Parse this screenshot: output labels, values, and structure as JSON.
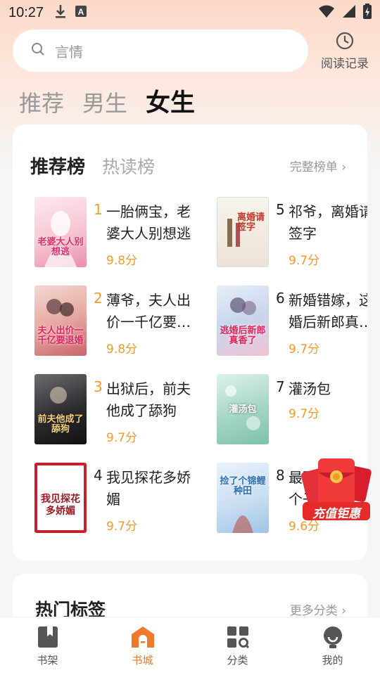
{
  "status_bar": {
    "time": "10:27"
  },
  "search": {
    "placeholder": "言情"
  },
  "history": {
    "label": "阅读记录"
  },
  "category_tabs": [
    {
      "label": "推荐",
      "active": false
    },
    {
      "label": "男生",
      "active": false
    },
    {
      "label": "女生",
      "active": true
    }
  ],
  "ranking": {
    "tabs": [
      {
        "label": "推荐榜",
        "active": true
      },
      {
        "label": "热读榜",
        "active": false
      }
    ],
    "more_label": "完整榜单 ›",
    "books": [
      {
        "rank": "1",
        "title": "一胎俩宝，老\n婆大人别想逃",
        "score": "9.8分",
        "cover_text": "老婆大人别想逃"
      },
      {
        "rank": "2",
        "title": "薄爷，夫人出\n价一千亿要…",
        "score": "9.8分",
        "cover_text": "夫人出价一千亿要退婚"
      },
      {
        "rank": "3",
        "title": "出狱后，前夫\n他成了舔狗",
        "score": "9.7分",
        "cover_text": "前夫他成了舔狗"
      },
      {
        "rank": "4",
        "title": "我见探花多娇\n媚",
        "score": "9.7分",
        "cover_text": "我见探花多娇媚"
      },
      {
        "rank": "5",
        "title": "祁爷，离婚请\n签字",
        "score": "9.7分",
        "cover_text": "离婚请签字"
      },
      {
        "rank": "6",
        "title": "新婚错嫁，这\n婚后新郎真…",
        "score": "9.7分",
        "cover_text": "逃婚后新郎真香了"
      },
      {
        "rank": "7",
        "title": "灌汤包",
        "score": "9.7分",
        "cover_text": "灌汤包"
      },
      {
        "rank": "8",
        "title": "最强\n个子",
        "score": "9.6分",
        "cover_text": "捡了个锦鲤种田"
      }
    ]
  },
  "promo": {
    "label": "充值钜惠"
  },
  "hot_tags": {
    "title": "热门标签",
    "more_label": "更多分类 ›"
  },
  "bottom_nav": [
    {
      "label": "书架",
      "icon": "bookshelf-icon",
      "active": false
    },
    {
      "label": "书城",
      "icon": "bookstore-icon",
      "active": true
    },
    {
      "label": "分类",
      "icon": "category-icon",
      "active": false
    },
    {
      "label": "我的",
      "icon": "profile-icon",
      "active": false
    }
  ],
  "colors": {
    "accent": "#f39a2b",
    "nav_active": "#f07a2b"
  }
}
